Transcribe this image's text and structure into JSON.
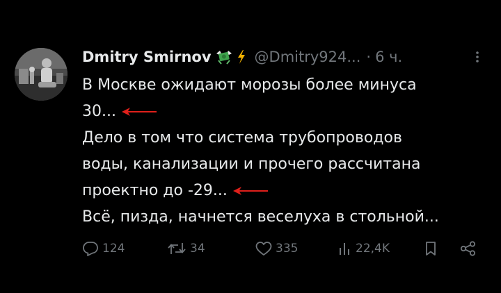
{
  "author": {
    "name": "Dmitry Smirnov",
    "handle": "@Dmitry924...",
    "separator": "·",
    "time": "6 ч.",
    "badge_icons": [
      "money-with-wings-icon",
      "lightning-icon"
    ]
  },
  "tweet": {
    "lines": [
      "В Москве ожидают морозы более минуса",
      "30...",
      "Дело в том что система трубопроводов",
      "воды, канализации и прочего рассчитана",
      "проектно до -29...",
      "Всё, пизда, начнется веселуха в стольной..."
    ],
    "annotation_color": "#e0201b"
  },
  "actions": {
    "replies": "124",
    "retweets": "34",
    "likes": "335",
    "views": "22,4K"
  },
  "colors": {
    "background": "#000000",
    "text": "#e7e9ea",
    "muted": "#71767b"
  }
}
